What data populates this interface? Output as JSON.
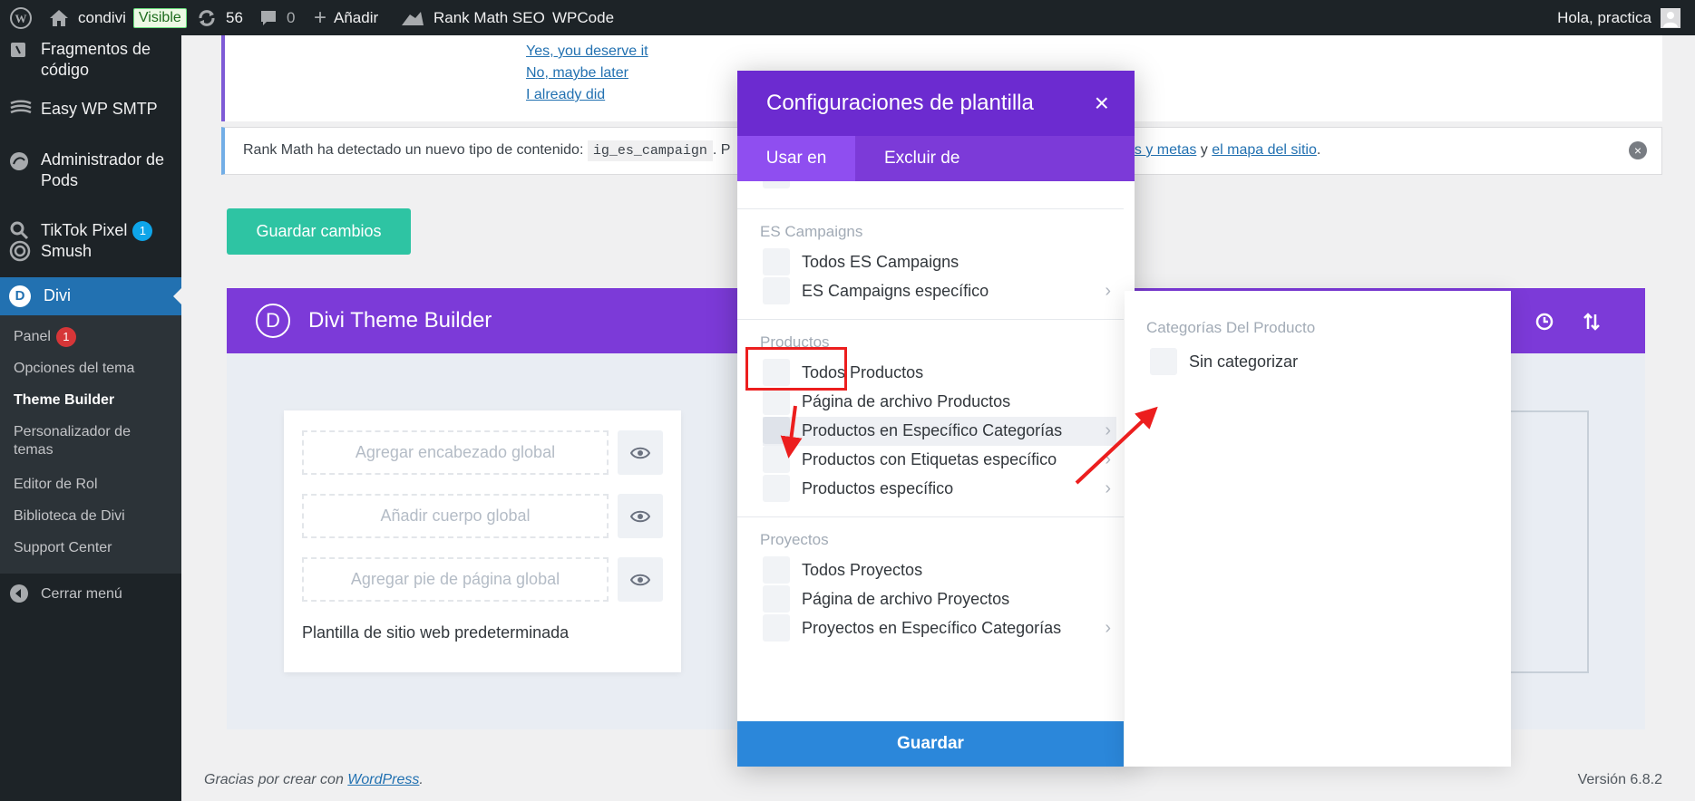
{
  "adminbar": {
    "site_name": "condivi",
    "visible_badge": "Visible",
    "updates_count": "56",
    "comments_count": "0",
    "add_new": "Añadir",
    "rankmath": "Rank Math SEO",
    "wpcode": "WPCode",
    "greeting": "Hola, practica"
  },
  "sidebar": {
    "items": [
      {
        "label": "Fragmentos de código",
        "icon": "code-snippet-icon"
      },
      {
        "label": "Easy WP SMTP",
        "icon": "smtp-icon"
      },
      {
        "label": "Administrador de Pods",
        "icon": "pods-icon"
      },
      {
        "label": "TikTok Pixel",
        "icon": "search-icon",
        "count": "1"
      },
      {
        "label": "Smush",
        "icon": "smush-icon"
      },
      {
        "label": "Divi",
        "icon": "divi-icon"
      }
    ],
    "submenu": [
      {
        "label": "Panel",
        "badge": "1"
      },
      {
        "label": "Opciones del tema"
      },
      {
        "label": "Theme Builder"
      },
      {
        "label": "Personalizador de temas"
      },
      {
        "label": "Editor de Rol"
      },
      {
        "label": "Biblioteca de Divi"
      },
      {
        "label": "Support Center"
      }
    ],
    "collapse": "Cerrar menú"
  },
  "review_notice": {
    "links": [
      "Yes, you deserve it",
      "No, maybe later",
      "I already did"
    ]
  },
  "rank_notice": {
    "text_before": "Rank Math ha detectado un nuevo tipo de contenido:",
    "code": "ig_es_campaign",
    "text_mid": ". P",
    "link1": "os y metas",
    "text_and": " y ",
    "link2": "el mapa del sitio",
    "text_end": "."
  },
  "save_changes": "Guardar cambios",
  "theme_builder": {
    "title": "Divi Theme Builder",
    "template": {
      "header_slot": "Agregar encabezado global",
      "body_slot": "Añadir cuerpo global",
      "footer_slot": "Agregar pie de página global",
      "name": "Plantilla de sitio web predeterminada"
    }
  },
  "modal": {
    "title": "Configuraciones de plantilla",
    "close": "×",
    "tabs": [
      "Usar en",
      "Excluir de"
    ],
    "sections": [
      {
        "heading": "ES Campaigns",
        "options": [
          {
            "label": "Todos ES Campaigns",
            "chevron": false
          },
          {
            "label": "ES Campaigns específico",
            "chevron": true
          }
        ]
      },
      {
        "heading": "Productos",
        "options": [
          {
            "label": "Todos Productos",
            "chevron": false
          },
          {
            "label": "Página de archivo Productos",
            "chevron": false
          },
          {
            "label": "Productos en Específico Categorías",
            "chevron": true
          },
          {
            "label": "Productos con Etiquetas específico",
            "chevron": true
          },
          {
            "label": "Productos específico",
            "chevron": true
          }
        ]
      },
      {
        "heading": "Proyectos",
        "options": [
          {
            "label": "Todos Proyectos",
            "chevron": false
          },
          {
            "label": "Página de archivo Proyectos",
            "chevron": false
          },
          {
            "label": "Proyectos en Específico Categorías",
            "chevron": true
          }
        ]
      }
    ],
    "save": "Guardar"
  },
  "subpanel": {
    "heading": "Categorías Del Producto",
    "option": "Sin categorizar"
  },
  "footer": {
    "left_prefix": "Gracias por crear con ",
    "left_link": "WordPress",
    "left_suffix": ".",
    "version": "Versión 6.8.2"
  },
  "colors": {
    "admin_dark": "#1d2327",
    "wp_blue": "#2271b1",
    "divi_purple": "#7c3ad8",
    "divi_teal": "#2ec4a3",
    "save_blue": "#2b87da",
    "annotation_red": "#ec1e1e"
  }
}
